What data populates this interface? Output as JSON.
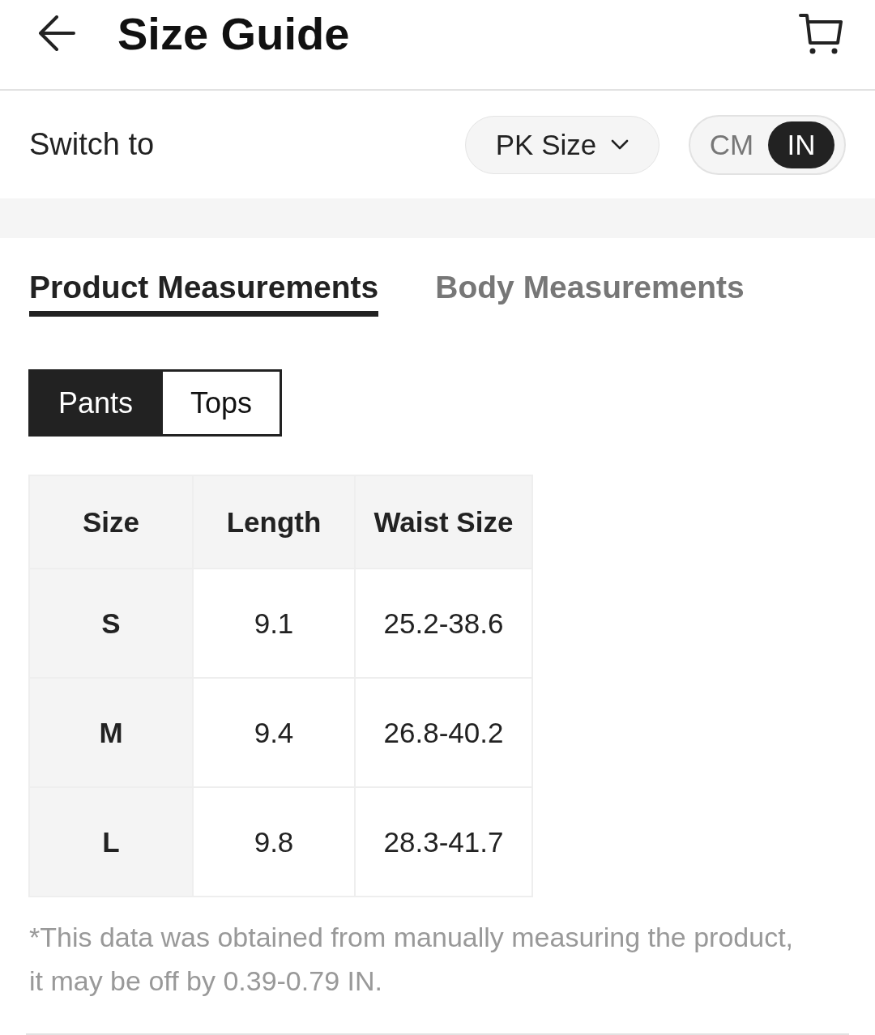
{
  "header": {
    "title": "Size Guide"
  },
  "switch_row": {
    "label": "Switch to",
    "size_system": "PK Size",
    "units": [
      {
        "label": "CM",
        "selected": false
      },
      {
        "label": "IN",
        "selected": true
      }
    ]
  },
  "measurement_tabs": [
    {
      "label": "Product Measurements",
      "selected": true
    },
    {
      "label": "Body Measurements",
      "selected": false
    }
  ],
  "category_tabs": [
    {
      "label": "Pants",
      "selected": true
    },
    {
      "label": "Tops",
      "selected": false
    }
  ],
  "table": {
    "columns": [
      "Size",
      "Length",
      "Waist Size"
    ],
    "rows": [
      [
        "S",
        "9.1",
        "25.2-38.6"
      ],
      [
        "M",
        "9.4",
        "26.8-40.2"
      ],
      [
        "L",
        "9.8",
        "28.3-41.7"
      ]
    ]
  },
  "note": "*This data was obtained from manually measuring the product, it may be off by 0.39-0.79 IN."
}
